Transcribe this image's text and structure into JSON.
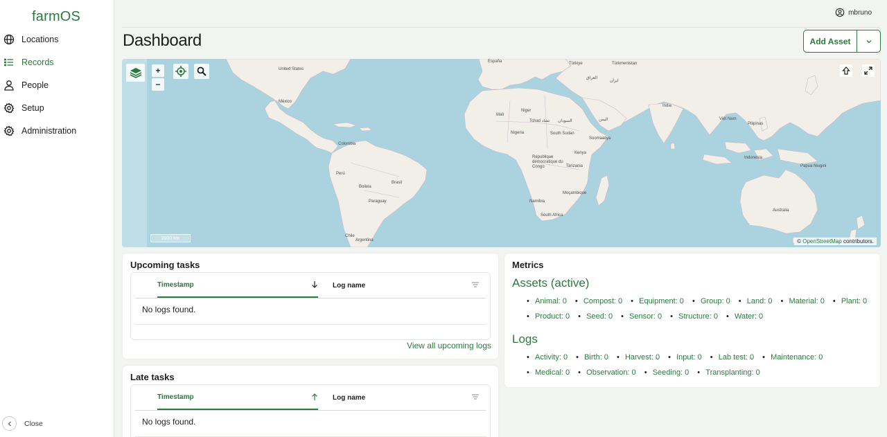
{
  "app": {
    "name": "farmOS"
  },
  "sidebar": {
    "items": [
      {
        "label": "Locations"
      },
      {
        "label": "Records"
      },
      {
        "label": "People"
      },
      {
        "label": "Setup"
      },
      {
        "label": "Administration"
      }
    ],
    "close_label": "Close"
  },
  "user": {
    "name": "mbruno"
  },
  "page": {
    "title": "Dashboard"
  },
  "add_asset": {
    "label": "Add Asset"
  },
  "map": {
    "attribution_prefix": "©",
    "attribution_link": "OpenStreetMap",
    "attribution_suffix": "contributors.",
    "scale": "2000 km",
    "zoom_in": "+",
    "zoom_out": "−",
    "labels": {
      "united_states": "United States",
      "mexico": "México",
      "colombia": "Colombia",
      "peru": "Perú",
      "brasil": "Brasil",
      "bolivia": "Bolivia",
      "paraguay": "Paraguay",
      "argentina": "Argentina",
      "chile": "Chile",
      "espana": "España",
      "mali": "Mali",
      "niger": "Niger",
      "nigeria": "Nigeria",
      "tchad": "Tchad تشاد",
      "sudan": "السودان",
      "south_sudan": "South Sudan",
      "kenya": "Kenya",
      "rdc": "République démocratique du Congo",
      "tanzania": "Tanzania",
      "namibia": "Namibia",
      "mocambique": "Moçambique",
      "south_africa": "South Africa",
      "somaliland": "Soomaaliya",
      "turkiye": "Türkiye",
      "turkmenistan": "Türkmenistan",
      "iraq": "العراق",
      "iran": "ایران",
      "india": "India",
      "yemen": "اليمن",
      "vietnam": "Việt Nam",
      "philippines": "Pilipinas",
      "indonesia": "Indonesia",
      "papua": "Papua Niugini",
      "australia": "Australia"
    }
  },
  "upcoming": {
    "title": "Upcoming tasks",
    "col_timestamp": "Timestamp",
    "col_logname": "Log name",
    "empty": "No logs found.",
    "view_all": "View all upcoming logs"
  },
  "late": {
    "title": "Late tasks",
    "col_timestamp": "Timestamp",
    "col_logname": "Log name",
    "empty": "No logs found."
  },
  "metrics": {
    "title": "Metrics",
    "assets_heading": "Assets (active)",
    "assets": [
      "Animal: 0",
      "Compost: 0",
      "Equipment: 0",
      "Group: 0",
      "Land: 0",
      "Material: 0",
      "Plant: 0",
      "Product: 0",
      "Seed: 0",
      "Sensor: 0",
      "Structure: 0",
      "Water: 0"
    ],
    "logs_heading": "Logs",
    "logs": [
      "Activity: 0",
      "Birth: 0",
      "Harvest: 0",
      "Input: 0",
      "Lab test: 0",
      "Maintenance: 0",
      "Medical: 0",
      "Observation: 0",
      "Seeding: 0",
      "Transplanting: 0"
    ]
  },
  "colors": {
    "brand": "#2a7a3e",
    "ocean": "#aad3df",
    "land": "#f2efe9"
  }
}
